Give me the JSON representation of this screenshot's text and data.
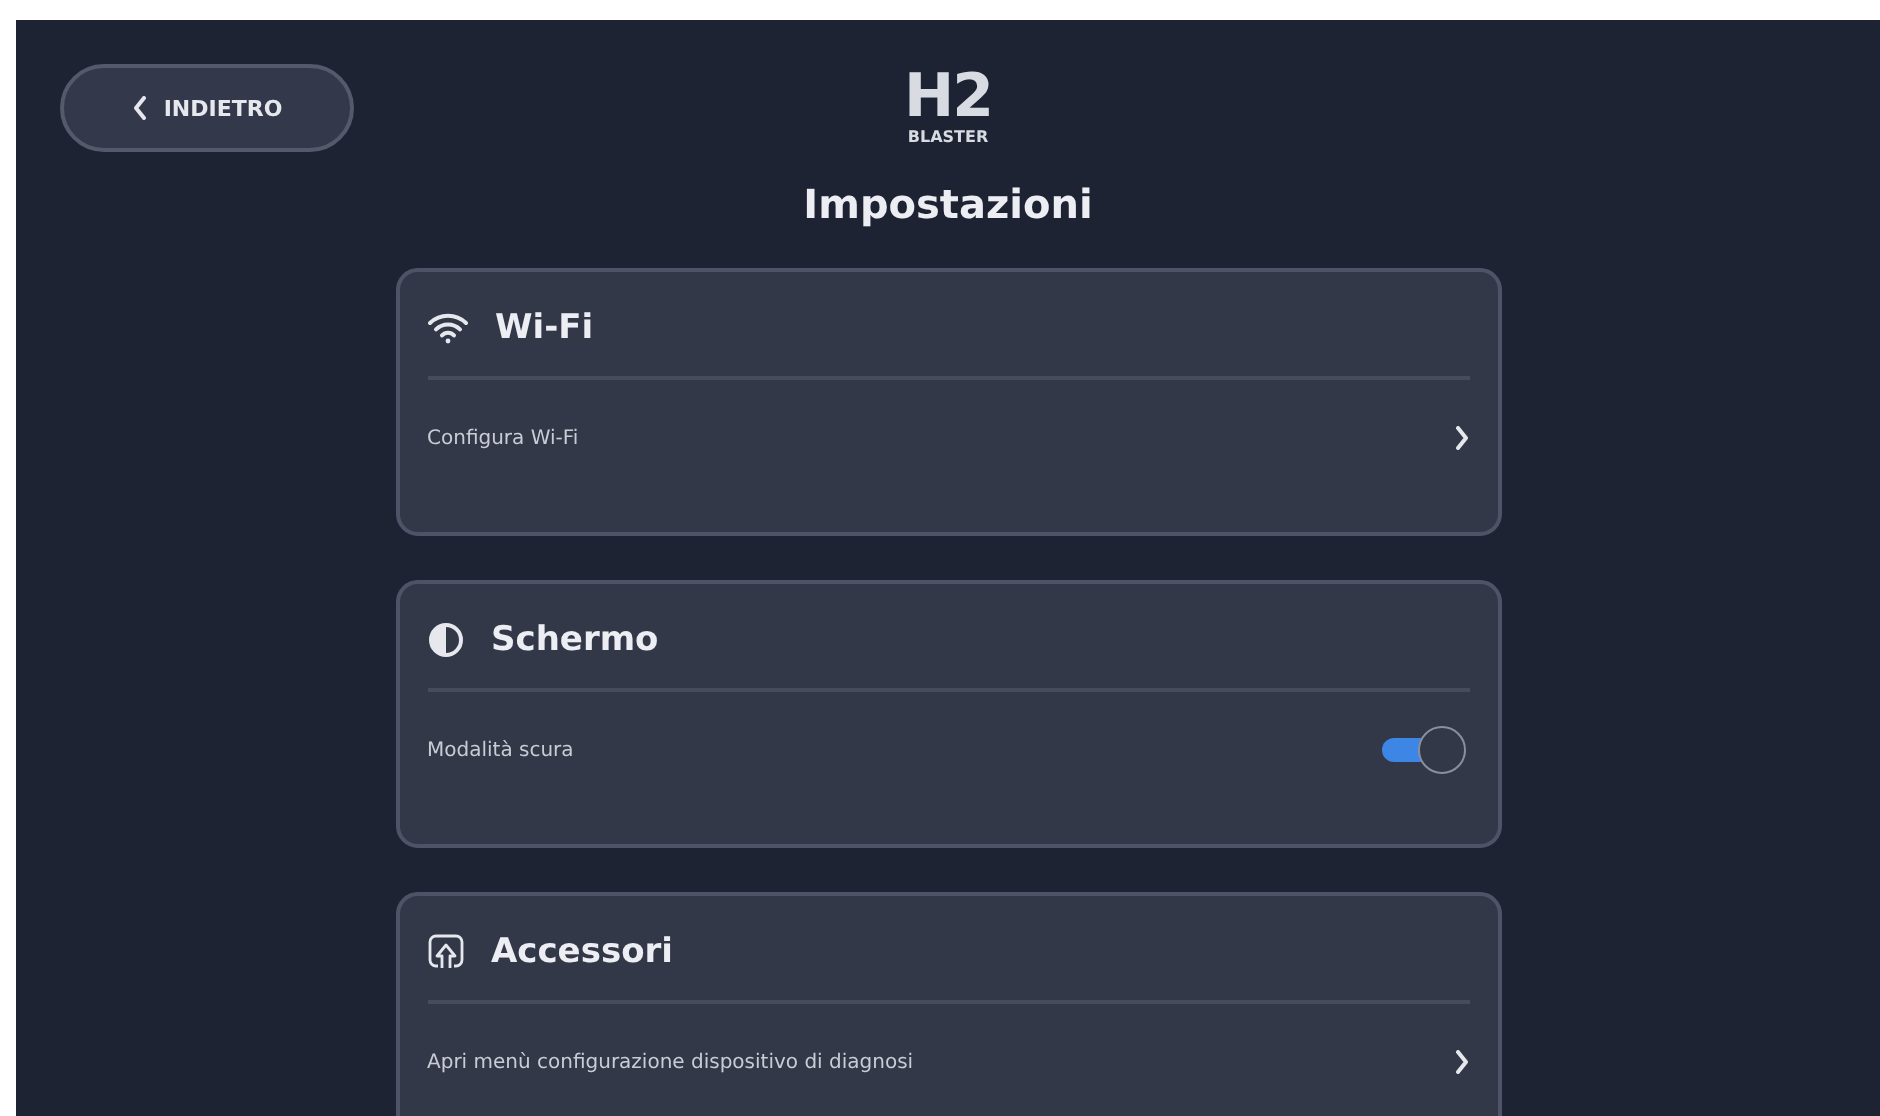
{
  "back_button": {
    "label": "INDIETRO"
  },
  "logo": {
    "main": "H2",
    "sub": "BLASTER"
  },
  "title": "Impostazioni",
  "sections": [
    {
      "title": "Wi-Fi",
      "rows": [
        {
          "kind": "link",
          "label": "Configura Wi-Fi"
        }
      ]
    },
    {
      "title": "Schermo",
      "rows": [
        {
          "kind": "toggle",
          "label": "Modalità scura",
          "on": true
        }
      ]
    },
    {
      "title": "Accessori",
      "rows": [
        {
          "kind": "link",
          "label": "Apri menù configurazione dispositivo di diagnosi"
        }
      ]
    }
  ]
}
